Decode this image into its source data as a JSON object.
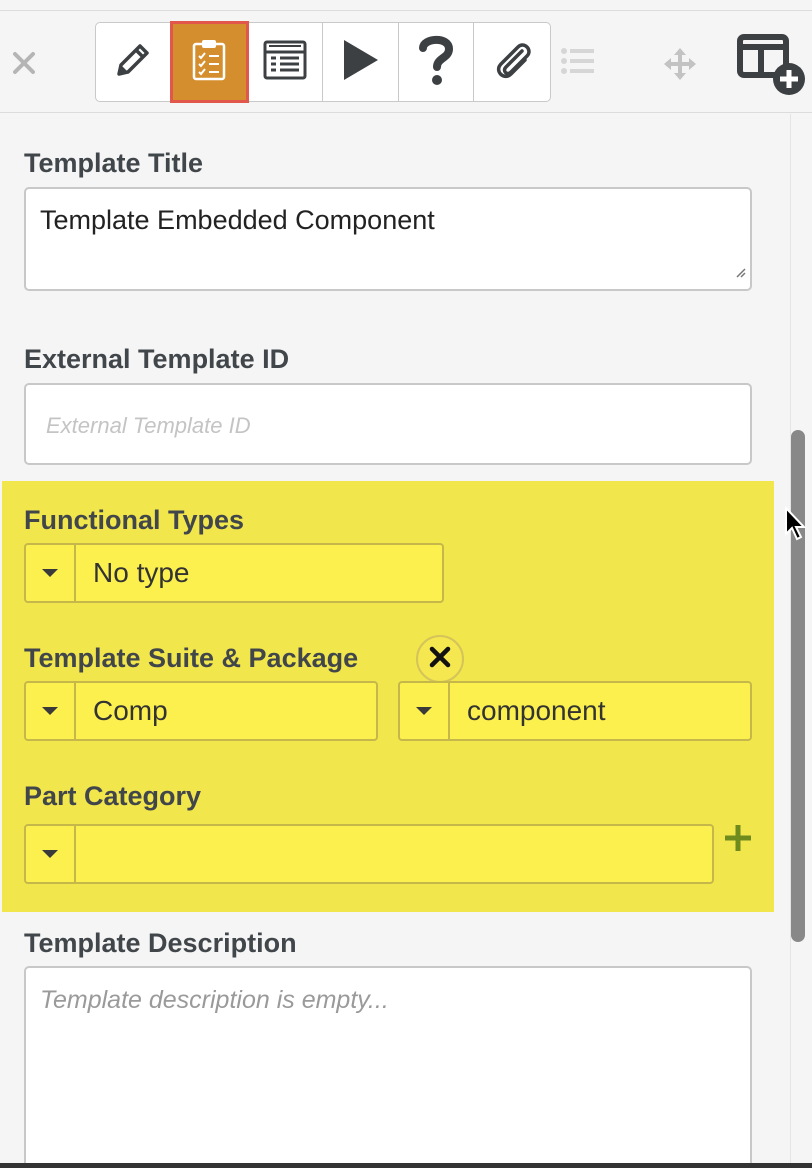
{
  "toolbar": {
    "close_icon": "close-icon",
    "buttons": [
      {
        "name": "edit",
        "icon": "pencil-icon",
        "active": false
      },
      {
        "name": "template-checklist",
        "icon": "clipboard-checklist-icon",
        "active": true
      },
      {
        "name": "preview",
        "icon": "form-list-icon",
        "active": false
      },
      {
        "name": "play",
        "icon": "play-icon",
        "active": false
      },
      {
        "name": "help",
        "icon": "question-icon",
        "active": false
      },
      {
        "name": "attach",
        "icon": "paperclip-icon",
        "active": false
      }
    ],
    "extra_icons": [
      "list-icon",
      "move-icon",
      "layout-add-icon"
    ],
    "active_color": "#d48e2e",
    "active_outline": "#e2574c"
  },
  "form": {
    "template_title": {
      "label": "Template Title",
      "value": "Template Embedded Component"
    },
    "external_id": {
      "label": "External Template ID",
      "placeholder": "External Template ID"
    },
    "functional_types": {
      "label": "Functional Types",
      "value": "No type"
    },
    "suite_package": {
      "label": "Template Suite & Package",
      "suite_value": "Comp",
      "package_value": "component"
    },
    "part_category": {
      "label": "Part Category",
      "value": ""
    },
    "description": {
      "label": "Template Description",
      "placeholder": "Template description is empty..."
    }
  },
  "highlight_color": "#f2e64d"
}
